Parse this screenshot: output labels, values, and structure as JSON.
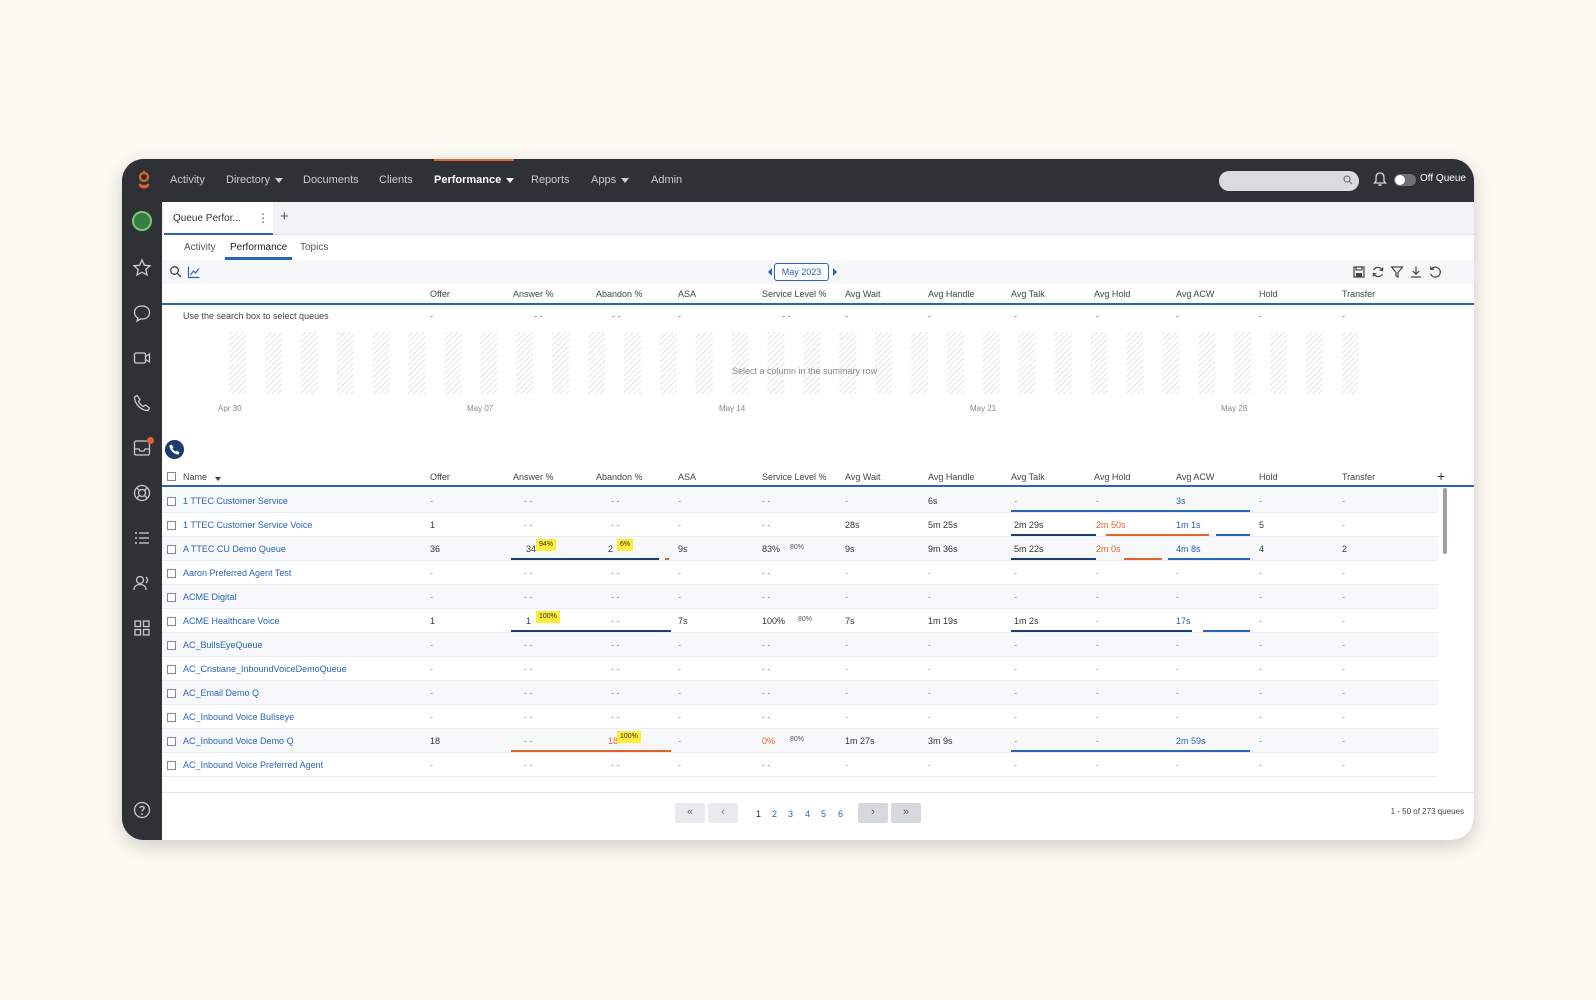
{
  "nav": {
    "items": [
      {
        "label": "Activity",
        "has_caret": false,
        "active": false
      },
      {
        "label": "Directory",
        "has_caret": true,
        "active": false
      },
      {
        "label": "Documents",
        "has_caret": false,
        "active": false
      },
      {
        "label": "Clients",
        "has_caret": false,
        "active": false
      },
      {
        "label": "Performance",
        "has_caret": true,
        "active": true
      },
      {
        "label": "Reports",
        "has_caret": false,
        "active": false
      },
      {
        "label": "Apps",
        "has_caret": true,
        "active": false
      },
      {
        "label": "Admin",
        "has_caret": false,
        "active": false
      }
    ],
    "search_placeholder": "",
    "status_label": "Off Queue",
    "accent_color": "#e2632c"
  },
  "sidebar": {
    "icons": [
      "avatar",
      "star-icon",
      "chat-icon",
      "video-icon",
      "phone-icon",
      "inbox-icon",
      "support-icon",
      "list-icon",
      "people-icon",
      "apps-grid-icon",
      "help-icon"
    ]
  },
  "tabs": {
    "current": "Queue Perfor...",
    "kebab": "⋮",
    "add": "+"
  },
  "subtabs": [
    "Activity",
    "Performance",
    "Topics"
  ],
  "toolbar": {
    "month": "May 2023"
  },
  "columns": [
    "Offer",
    "Answer %",
    "Abandon %",
    "ASA",
    "Service Level %",
    "Avg Wait",
    "Avg Handle",
    "Avg Talk",
    "Avg Hold",
    "Avg ACW",
    "Hold",
    "Transfer"
  ],
  "summary": {
    "prompt": "Use the search box to select queues",
    "values": [
      "-",
      "- -",
      "- -",
      "-",
      "- -",
      "-",
      "-",
      "-",
      "-",
      "-",
      "-",
      "-"
    ]
  },
  "chart": {
    "x_ticks": [
      "Apr 30",
      "May 07",
      "May 14",
      "May 21",
      "May 28"
    ],
    "message": "Select a column in the summary row"
  },
  "table": {
    "name_header": "Name",
    "rows": [
      {
        "name": "1 TTEC Customer Service",
        "offer": "-",
        "answer": "- -",
        "abandon": "- -",
        "asa": "-",
        "sl": "- -",
        "wait": "-",
        "handle": "6s",
        "talk": "-",
        "hold_avg": "-",
        "acw": "3s",
        "hold": "-",
        "transfer": "-"
      },
      {
        "name": "1 TTEC Customer Service Voice",
        "offer": "1",
        "answer": "- -",
        "abandon": "- -",
        "asa": "-",
        "sl": "- -",
        "wait": "28s",
        "handle": "5m 25s",
        "talk": "2m 29s",
        "hold_avg": "2m 50s",
        "acw": "1m 1s",
        "hold": "5",
        "transfer": "-"
      },
      {
        "name": "A TTEC CU Demo Queue",
        "offer": "36",
        "answer": "34",
        "answer_pct": "94%",
        "abandon": "2",
        "abandon_pct": "6%",
        "asa": "9s",
        "sl": "83%",
        "sl_target": "80%",
        "wait": "9s",
        "handle": "9m 36s",
        "talk": "5m 22s",
        "hold_avg": "2m 0s",
        "acw": "4m 8s",
        "hold": "4",
        "transfer": "2"
      },
      {
        "name": "Aaron Preferred Agent Test",
        "offer": "-",
        "answer": "- -",
        "abandon": "- -",
        "asa": "-",
        "sl": "- -",
        "wait": "-",
        "handle": "-",
        "talk": "-",
        "hold_avg": "-",
        "acw": "-",
        "hold": "-",
        "transfer": "-"
      },
      {
        "name": "ACME Digital",
        "offer": "-",
        "answer": "- -",
        "abandon": "- -",
        "asa": "-",
        "sl": "- -",
        "wait": "-",
        "handle": "-",
        "talk": "-",
        "hold_avg": "-",
        "acw": "-",
        "hold": "-",
        "transfer": "-"
      },
      {
        "name": "ACME Healthcare Voice",
        "offer": "1",
        "answer": "1",
        "answer_pct": "100%",
        "abandon": "- -",
        "asa": "7s",
        "sl": "100%",
        "sl_target": "80%",
        "wait": "7s",
        "handle": "1m 19s",
        "talk": "1m 2s",
        "hold_avg": "-",
        "acw": "17s",
        "hold": "-",
        "transfer": "-"
      },
      {
        "name": "AC_BullsEyeQueue",
        "offer": "-",
        "answer": "- -",
        "abandon": "- -",
        "asa": "-",
        "sl": "- -",
        "wait": "-",
        "handle": "-",
        "talk": "-",
        "hold_avg": "-",
        "acw": "-",
        "hold": "-",
        "transfer": "-"
      },
      {
        "name": "AC_Cristiane_InboundVoiceDemoQueue",
        "offer": "-",
        "answer": "- -",
        "abandon": "- -",
        "asa": "-",
        "sl": "- -",
        "wait": "-",
        "handle": "-",
        "talk": "-",
        "hold_avg": "-",
        "acw": "-",
        "hold": "-",
        "transfer": "-"
      },
      {
        "name": "AC_Email Demo Q",
        "offer": "-",
        "answer": "- -",
        "abandon": "- -",
        "asa": "-",
        "sl": "- -",
        "wait": "-",
        "handle": "-",
        "talk": "-",
        "hold_avg": "-",
        "acw": "-",
        "hold": "-",
        "transfer": "-"
      },
      {
        "name": "AC_Inbound Voice Bullseye",
        "offer": "-",
        "answer": "- -",
        "abandon": "- -",
        "asa": "-",
        "sl": "- -",
        "wait": "-",
        "handle": "-",
        "talk": "-",
        "hold_avg": "-",
        "acw": "-",
        "hold": "-",
        "transfer": "-"
      },
      {
        "name": "AC_Inbound Voice Demo Q",
        "offer": "18",
        "answer": "- -",
        "abandon": "18",
        "abandon_pct": "100%",
        "asa": "-",
        "sl": "0%",
        "sl_target": "80%",
        "wait": "1m 27s",
        "handle": "3m 9s",
        "talk": "-",
        "hold_avg": "-",
        "acw": "2m 59s",
        "hold": "-",
        "transfer": "-"
      },
      {
        "name": "AC_Inbound Voice Preferred Agent",
        "offer": "-",
        "answer": "- -",
        "abandon": "- -",
        "asa": "-",
        "sl": "- -",
        "wait": "-",
        "handle": "-",
        "talk": "-",
        "hold_avg": "-",
        "acw": "-",
        "hold": "-",
        "transfer": "-"
      }
    ]
  },
  "pager": {
    "first": "«",
    "prev": "‹",
    "next": "›",
    "last": "»",
    "pages": [
      "1",
      "2",
      "3",
      "4",
      "5",
      "6"
    ],
    "current": "1",
    "info": "1 - 50 of 273 queues"
  }
}
